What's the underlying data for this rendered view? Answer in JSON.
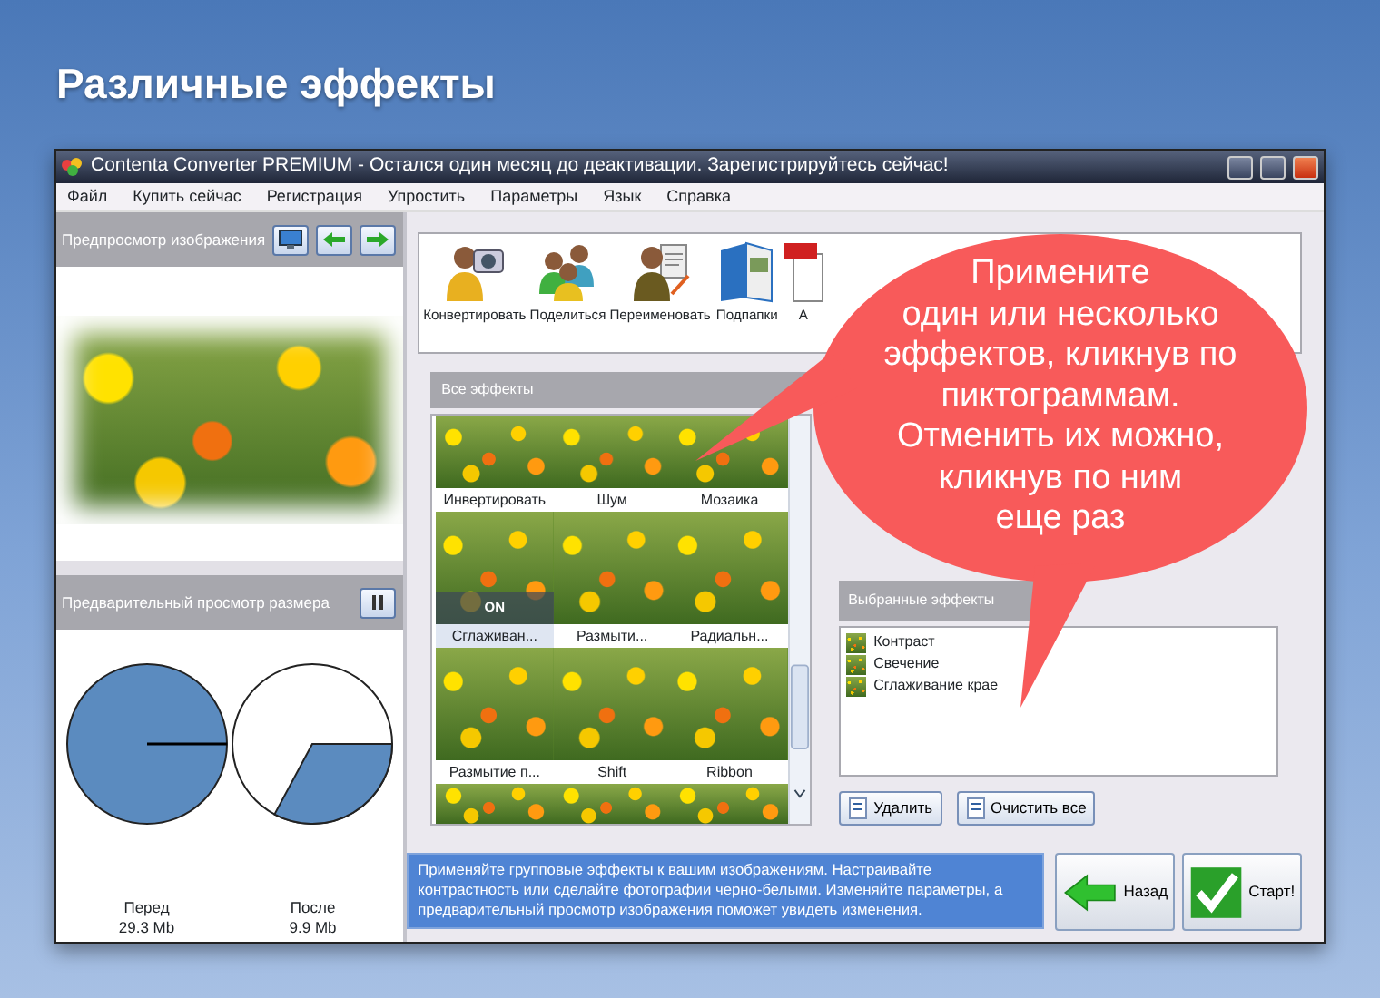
{
  "heading": "Различные эффекты",
  "window": {
    "title": "Contenta Converter PREMIUM  - Остался один месяц до деактивации. Зарегистрируйтесь сейчас!"
  },
  "menu": [
    "Файл",
    "Купить сейчас",
    "Регистрация",
    "Упростить",
    "Параметры",
    "Язык",
    "Справка"
  ],
  "preview": {
    "title": "Предпросмотр изображения"
  },
  "size_preview": {
    "title": "Предварительный просмотр размера",
    "pies": [
      {
        "kind": "full",
        "label": "Перед",
        "size": "29.3 Mb"
      },
      {
        "kind": "partial",
        "label": "После",
        "size": "9.9 Mb"
      }
    ]
  },
  "toolbar": [
    {
      "kind": "camera",
      "label": "Конвертировать"
    },
    {
      "kind": "group",
      "label": "Поделиться"
    },
    {
      "kind": "document",
      "label": "Переименовать"
    },
    {
      "kind": "folder",
      "label": "Подпапки"
    },
    {
      "kind": "pdf",
      "label": "А"
    }
  ],
  "effects": {
    "title": "Все эффекты",
    "tiles": [
      {
        "label": "Инвертировать",
        "selected": false
      },
      {
        "label": "Шум",
        "selected": false
      },
      {
        "label": "Мозаика",
        "selected": false
      },
      {
        "label": "Сглаживан...",
        "selected": true,
        "on_label": "ON"
      },
      {
        "label": "Размыти...",
        "selected": false
      },
      {
        "label": "Радиальн...",
        "selected": false
      },
      {
        "label": "Размытие п...",
        "selected": false
      },
      {
        "label": "Shift",
        "selected": false
      },
      {
        "label": "Ribbon",
        "selected": false
      }
    ]
  },
  "selected_effects": {
    "title": "Выбранные эффекты",
    "items": [
      "Контраст",
      "Свечение",
      "Сглаживание крае"
    ],
    "buttons": [
      "Удалить",
      "Очистить все"
    ]
  },
  "info": "Применяйте групповые эффекты к вашим изображениям. Настраивайте контрастность или сделайте фотографии черно-белыми. Изменяйте параметры, а предварительный просмотр изображения поможет увидеть изменения.",
  "nav": [
    {
      "kind": "back",
      "label": "Назад"
    },
    {
      "kind": "start",
      "label": "Старт!"
    }
  ],
  "bubble": {
    "lines": [
      "Примените",
      "один или несколько",
      "эффектов, кликнув по",
      "пиктограммам.",
      "Отменить их можно,",
      "кликнув по ним",
      "еще раз"
    ]
  }
}
